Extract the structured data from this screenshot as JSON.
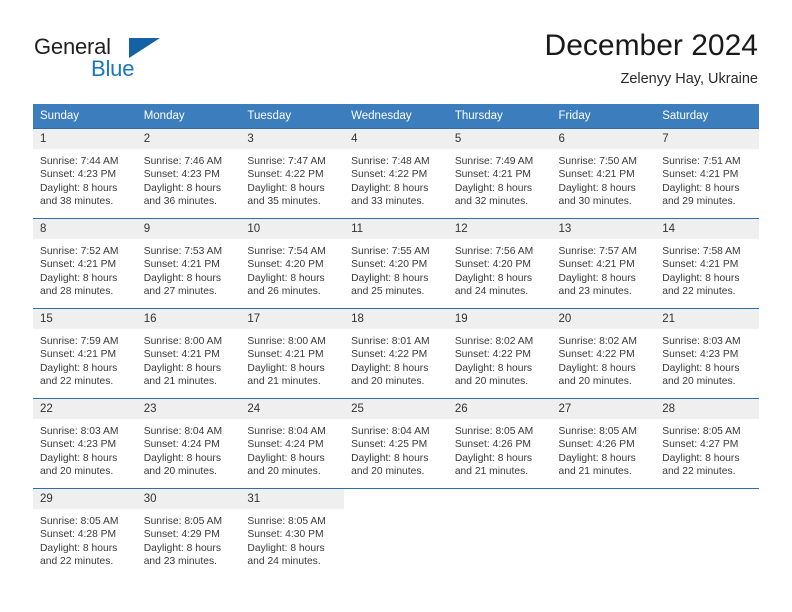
{
  "brand": {
    "name_part1": "General",
    "name_part2": "Blue",
    "triangle_icon": "triangle-icon",
    "accent_color": "#1878be",
    "triangle_color": "#1461a5"
  },
  "header": {
    "title": "December 2024",
    "subtitle": "Zelenyy Hay, Ukraine"
  },
  "calendar": {
    "header_bg": "#3b7dbd",
    "row_divider_color": "#2f6fae",
    "daynum_bg": "#efefef",
    "weekday_headers": [
      "Sunday",
      "Monday",
      "Tuesday",
      "Wednesday",
      "Thursday",
      "Friday",
      "Saturday"
    ],
    "weeks": [
      [
        {
          "day": "1",
          "sunrise": "Sunrise: 7:44 AM",
          "sunset": "Sunset: 4:23 PM",
          "daylight1": "Daylight: 8 hours",
          "daylight2": "and 38 minutes."
        },
        {
          "day": "2",
          "sunrise": "Sunrise: 7:46 AM",
          "sunset": "Sunset: 4:23 PM",
          "daylight1": "Daylight: 8 hours",
          "daylight2": "and 36 minutes."
        },
        {
          "day": "3",
          "sunrise": "Sunrise: 7:47 AM",
          "sunset": "Sunset: 4:22 PM",
          "daylight1": "Daylight: 8 hours",
          "daylight2": "and 35 minutes."
        },
        {
          "day": "4",
          "sunrise": "Sunrise: 7:48 AM",
          "sunset": "Sunset: 4:22 PM",
          "daylight1": "Daylight: 8 hours",
          "daylight2": "and 33 minutes."
        },
        {
          "day": "5",
          "sunrise": "Sunrise: 7:49 AM",
          "sunset": "Sunset: 4:21 PM",
          "daylight1": "Daylight: 8 hours",
          "daylight2": "and 32 minutes."
        },
        {
          "day": "6",
          "sunrise": "Sunrise: 7:50 AM",
          "sunset": "Sunset: 4:21 PM",
          "daylight1": "Daylight: 8 hours",
          "daylight2": "and 30 minutes."
        },
        {
          "day": "7",
          "sunrise": "Sunrise: 7:51 AM",
          "sunset": "Sunset: 4:21 PM",
          "daylight1": "Daylight: 8 hours",
          "daylight2": "and 29 minutes."
        }
      ],
      [
        {
          "day": "8",
          "sunrise": "Sunrise: 7:52 AM",
          "sunset": "Sunset: 4:21 PM",
          "daylight1": "Daylight: 8 hours",
          "daylight2": "and 28 minutes."
        },
        {
          "day": "9",
          "sunrise": "Sunrise: 7:53 AM",
          "sunset": "Sunset: 4:21 PM",
          "daylight1": "Daylight: 8 hours",
          "daylight2": "and 27 minutes."
        },
        {
          "day": "10",
          "sunrise": "Sunrise: 7:54 AM",
          "sunset": "Sunset: 4:20 PM",
          "daylight1": "Daylight: 8 hours",
          "daylight2": "and 26 minutes."
        },
        {
          "day": "11",
          "sunrise": "Sunrise: 7:55 AM",
          "sunset": "Sunset: 4:20 PM",
          "daylight1": "Daylight: 8 hours",
          "daylight2": "and 25 minutes."
        },
        {
          "day": "12",
          "sunrise": "Sunrise: 7:56 AM",
          "sunset": "Sunset: 4:20 PM",
          "daylight1": "Daylight: 8 hours",
          "daylight2": "and 24 minutes."
        },
        {
          "day": "13",
          "sunrise": "Sunrise: 7:57 AM",
          "sunset": "Sunset: 4:21 PM",
          "daylight1": "Daylight: 8 hours",
          "daylight2": "and 23 minutes."
        },
        {
          "day": "14",
          "sunrise": "Sunrise: 7:58 AM",
          "sunset": "Sunset: 4:21 PM",
          "daylight1": "Daylight: 8 hours",
          "daylight2": "and 22 minutes."
        }
      ],
      [
        {
          "day": "15",
          "sunrise": "Sunrise: 7:59 AM",
          "sunset": "Sunset: 4:21 PM",
          "daylight1": "Daylight: 8 hours",
          "daylight2": "and 22 minutes."
        },
        {
          "day": "16",
          "sunrise": "Sunrise: 8:00 AM",
          "sunset": "Sunset: 4:21 PM",
          "daylight1": "Daylight: 8 hours",
          "daylight2": "and 21 minutes."
        },
        {
          "day": "17",
          "sunrise": "Sunrise: 8:00 AM",
          "sunset": "Sunset: 4:21 PM",
          "daylight1": "Daylight: 8 hours",
          "daylight2": "and 21 minutes."
        },
        {
          "day": "18",
          "sunrise": "Sunrise: 8:01 AM",
          "sunset": "Sunset: 4:22 PM",
          "daylight1": "Daylight: 8 hours",
          "daylight2": "and 20 minutes."
        },
        {
          "day": "19",
          "sunrise": "Sunrise: 8:02 AM",
          "sunset": "Sunset: 4:22 PM",
          "daylight1": "Daylight: 8 hours",
          "daylight2": "and 20 minutes."
        },
        {
          "day": "20",
          "sunrise": "Sunrise: 8:02 AM",
          "sunset": "Sunset: 4:22 PM",
          "daylight1": "Daylight: 8 hours",
          "daylight2": "and 20 minutes."
        },
        {
          "day": "21",
          "sunrise": "Sunrise: 8:03 AM",
          "sunset": "Sunset: 4:23 PM",
          "daylight1": "Daylight: 8 hours",
          "daylight2": "and 20 minutes."
        }
      ],
      [
        {
          "day": "22",
          "sunrise": "Sunrise: 8:03 AM",
          "sunset": "Sunset: 4:23 PM",
          "daylight1": "Daylight: 8 hours",
          "daylight2": "and 20 minutes."
        },
        {
          "day": "23",
          "sunrise": "Sunrise: 8:04 AM",
          "sunset": "Sunset: 4:24 PM",
          "daylight1": "Daylight: 8 hours",
          "daylight2": "and 20 minutes."
        },
        {
          "day": "24",
          "sunrise": "Sunrise: 8:04 AM",
          "sunset": "Sunset: 4:24 PM",
          "daylight1": "Daylight: 8 hours",
          "daylight2": "and 20 minutes."
        },
        {
          "day": "25",
          "sunrise": "Sunrise: 8:04 AM",
          "sunset": "Sunset: 4:25 PM",
          "daylight1": "Daylight: 8 hours",
          "daylight2": "and 20 minutes."
        },
        {
          "day": "26",
          "sunrise": "Sunrise: 8:05 AM",
          "sunset": "Sunset: 4:26 PM",
          "daylight1": "Daylight: 8 hours",
          "daylight2": "and 21 minutes."
        },
        {
          "day": "27",
          "sunrise": "Sunrise: 8:05 AM",
          "sunset": "Sunset: 4:26 PM",
          "daylight1": "Daylight: 8 hours",
          "daylight2": "and 21 minutes."
        },
        {
          "day": "28",
          "sunrise": "Sunrise: 8:05 AM",
          "sunset": "Sunset: 4:27 PM",
          "daylight1": "Daylight: 8 hours",
          "daylight2": "and 22 minutes."
        }
      ],
      [
        {
          "day": "29",
          "sunrise": "Sunrise: 8:05 AM",
          "sunset": "Sunset: 4:28 PM",
          "daylight1": "Daylight: 8 hours",
          "daylight2": "and 22 minutes."
        },
        {
          "day": "30",
          "sunrise": "Sunrise: 8:05 AM",
          "sunset": "Sunset: 4:29 PM",
          "daylight1": "Daylight: 8 hours",
          "daylight2": "and 23 minutes."
        },
        {
          "day": "31",
          "sunrise": "Sunrise: 8:05 AM",
          "sunset": "Sunset: 4:30 PM",
          "daylight1": "Daylight: 8 hours",
          "daylight2": "and 24 minutes."
        },
        {
          "day": "",
          "sunrise": "",
          "sunset": "",
          "daylight1": "",
          "daylight2": ""
        },
        {
          "day": "",
          "sunrise": "",
          "sunset": "",
          "daylight1": "",
          "daylight2": ""
        },
        {
          "day": "",
          "sunrise": "",
          "sunset": "",
          "daylight1": "",
          "daylight2": ""
        },
        {
          "day": "",
          "sunrise": "",
          "sunset": "",
          "daylight1": "",
          "daylight2": ""
        }
      ]
    ]
  }
}
